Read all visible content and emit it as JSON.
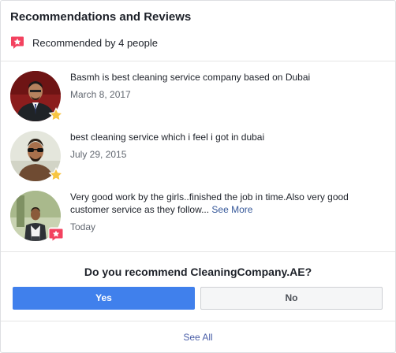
{
  "header": {
    "title": "Recommendations and Reviews",
    "recommended_text": "Recommended by 4 people"
  },
  "colors": {
    "recommend_icon": "#f3425f",
    "star": "#f7c542",
    "primary_button": "#4080ec",
    "link": "#365899"
  },
  "reviews": [
    {
      "text": "Basmh is best cleaning service company based on Dubai",
      "date": "March 8, 2017",
      "badge_icon": "star-icon"
    },
    {
      "text": "best cleaning service which i feel i got in dubai",
      "date": "July 29, 2015",
      "badge_icon": "star-icon"
    },
    {
      "text": "Very good work by the girls..finished the job in time.Also very good customer service as they follow...",
      "see_more": "See More",
      "date": "Today",
      "badge_icon": "recommend-flag-icon"
    }
  ],
  "question": {
    "text": "Do you recommend CleaningCompany.AE?",
    "yes_label": "Yes",
    "no_label": "No"
  },
  "footer": {
    "see_all": "See All"
  }
}
